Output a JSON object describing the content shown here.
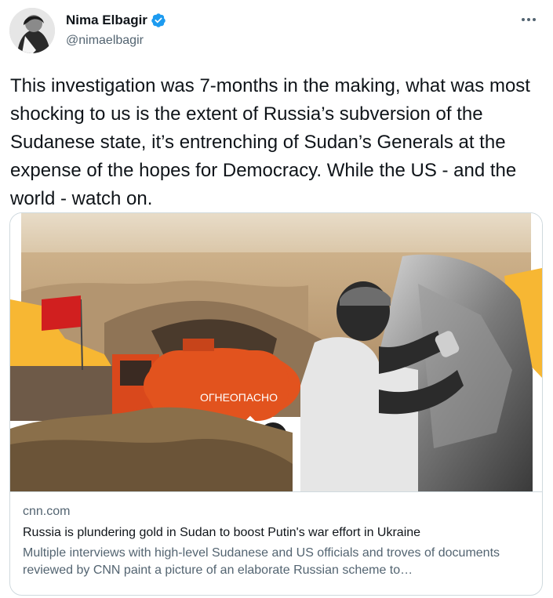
{
  "author": {
    "name": "Nima Elbagir",
    "handle": "@nimaelbagir",
    "verified": true
  },
  "more_icon": "more-horizontal-icon",
  "tweet_text": "This investigation was 7-months in the making, what was most shocking to us is the extent of Russia’s subversion of the Sudanese state, it’s entrenching of Sudan’s Generals at the expense of the hopes for Democracy. While the US - and the world - watch on.",
  "card": {
    "domain": "cnn.com",
    "title": "Russia is plundering gold in Sudan to boost Putin's war effort in Ukraine",
    "description": "Multiple interviews with high-level Sudanese and US officials and troves of documents reviewed by CNN paint a picture of an elaborate Russian scheme to…",
    "image_truck_label": "ОГНЕОПАСНО"
  },
  "colors": {
    "text": "#0f1419",
    "secondary": "#536471",
    "verified": "#1d9bf0",
    "border": "#cfd9de"
  }
}
